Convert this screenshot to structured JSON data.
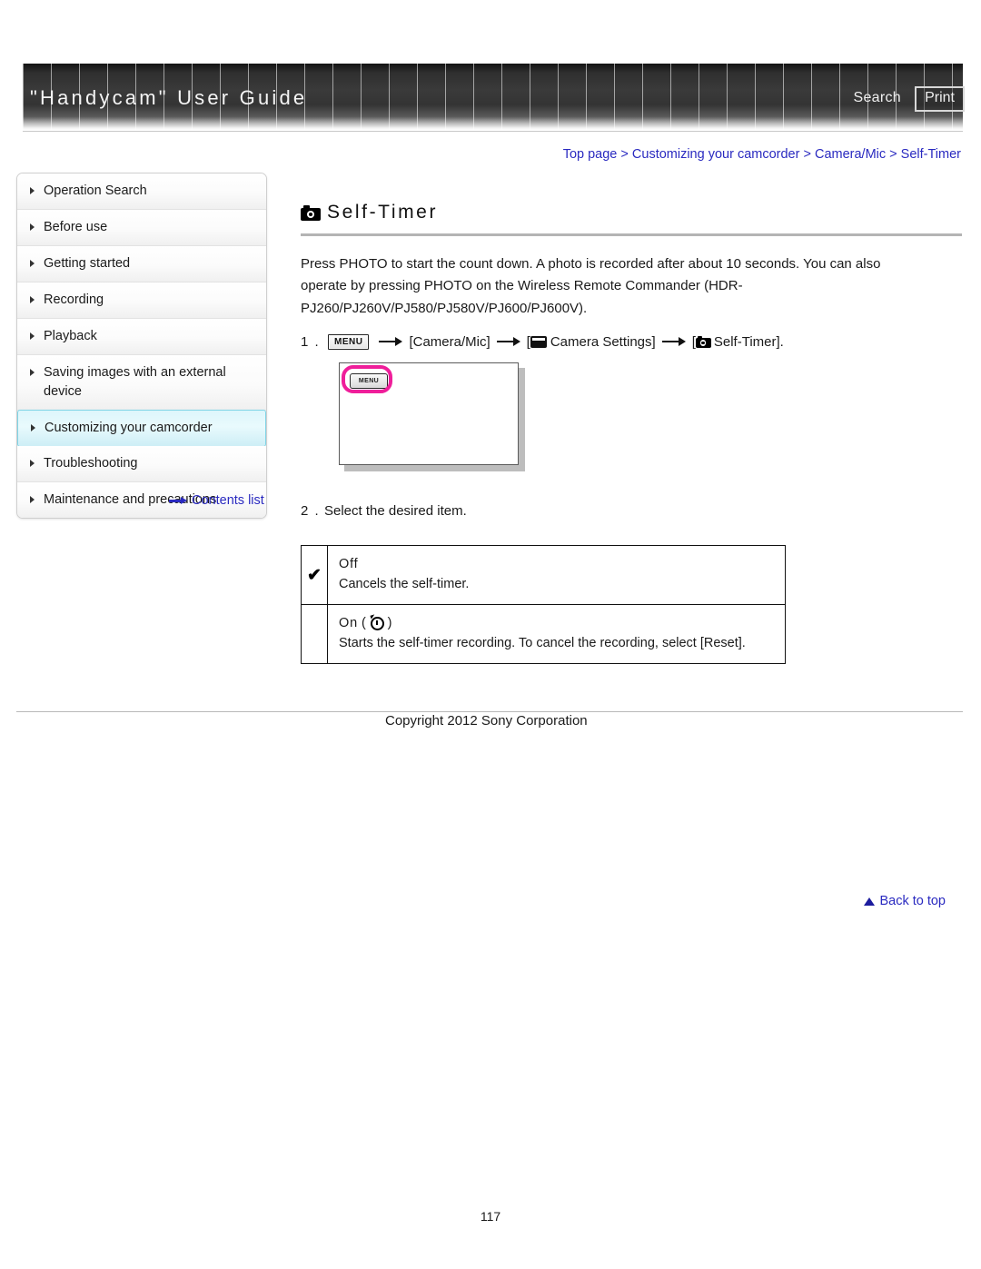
{
  "header": {
    "title": "\"Handycam\" User Guide",
    "search_label": "Search",
    "print_label": "Print"
  },
  "breadcrumb": {
    "items": [
      "Top page",
      "Customizing your camcorder",
      "Camera/Mic",
      "Self-Timer"
    ],
    "separator": ">",
    "full_text": "Top page > Customizing your camcorder > Camera/Mic > Self-Timer",
    "link_color": "#2a2ac0"
  },
  "sidebar": {
    "items": [
      {
        "label": "Operation Search",
        "active": false
      },
      {
        "label": "Before use",
        "active": false
      },
      {
        "label": "Getting started",
        "active": false
      },
      {
        "label": "Recording",
        "active": false
      },
      {
        "label": "Playback",
        "active": false
      },
      {
        "label": "Saving images with an external device",
        "active": false
      },
      {
        "label": "Customizing your camcorder",
        "active": true
      },
      {
        "label": "Troubleshooting",
        "active": false
      },
      {
        "label": "Maintenance and precautions",
        "active": false
      }
    ],
    "contents_list_label": "Contents list",
    "active_color": "#7fd4e6"
  },
  "main": {
    "title": "Self-Timer",
    "title_icon": "camera-icon",
    "intro": "Press PHOTO to start the count down. A photo is recorded after about 10 seconds. You can also operate by pressing PHOTO on the Wireless Remote Commander (HDR-PJ260/PJ260V/PJ580/PJ580V/PJ600/PJ600V).",
    "step1": {
      "number": "1 .",
      "menu_chip": "MENU",
      "arrow": "→",
      "part1": "[Camera/Mic]",
      "part2_open": "[",
      "part2": "Camera Settings]",
      "part3_open": "[",
      "part3": "Self-Timer]."
    },
    "illustration": {
      "menu_button_label": "MENU",
      "highlight_color": "#ef1e9a"
    },
    "step2": {
      "number": "2 .",
      "text": "Select the desired item."
    },
    "options": [
      {
        "checked": true,
        "check_glyph": "✔",
        "name": "Off",
        "icon": "",
        "description": "Cancels the self-timer."
      },
      {
        "checked": false,
        "check_glyph": "",
        "name": "On",
        "icon": "self-timer-icon",
        "icon_open": "(",
        "icon_close": ")",
        "description": "Starts the self-timer recording. To cancel the recording, select [Reset]."
      }
    ]
  },
  "footer": {
    "back_to_top_label": "Back to top",
    "copyright": "Copyright 2012 Sony Corporation",
    "page_number": "117"
  }
}
